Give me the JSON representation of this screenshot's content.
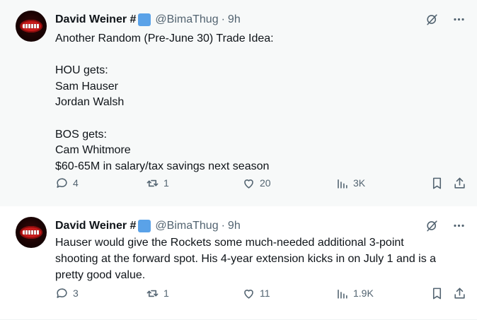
{
  "tweets": [
    {
      "author_name": "David Weiner #",
      "handle": "@BimaThug",
      "separator": "·",
      "time": "9h",
      "lines": [
        "Another Random (Pre-June 30) Trade Idea:",
        "",
        "HOU gets:",
        "Sam Hauser",
        "Jordan Walsh",
        "",
        "BOS gets:",
        "Cam Whitmore",
        "$60-65M in salary/tax savings next season"
      ],
      "replies": "4",
      "retweets": "1",
      "likes": "20",
      "views": "3K"
    },
    {
      "author_name": "David Weiner #",
      "handle": "@BimaThug",
      "separator": "·",
      "time": "9h",
      "lines": [
        "Hauser would give the Rockets some much-needed additional 3-point",
        "shooting at the forward spot. His 4-year extension kicks in on July 1 and is a",
        "pretty good value."
      ],
      "replies": "3",
      "retweets": "1",
      "likes": "11",
      "views": "1.9K"
    }
  ],
  "colors": {
    "text": "#0f1419",
    "muted": "#536471",
    "badge": "#5aa2e8",
    "thread_line": "#cfd9de",
    "highlight_bg": "#f7f9f9"
  },
  "icons": [
    "reply-icon",
    "retweet-icon",
    "like-icon",
    "views-icon",
    "bookmark-icon",
    "share-icon",
    "grok-icon",
    "more-icon"
  ]
}
